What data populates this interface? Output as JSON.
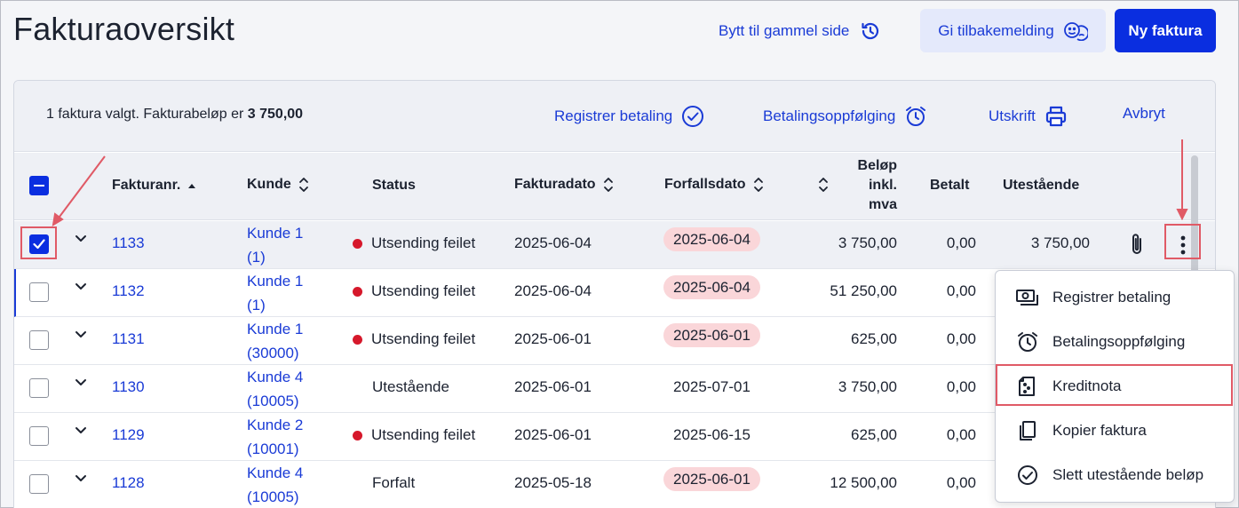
{
  "header": {
    "title": "Fakturaoversikt",
    "old_page_link": "Bytt til gammel side",
    "feedback_button": "Gi tilbakemelding",
    "new_invoice_button": "Ny faktura"
  },
  "selection_bar": {
    "text": "1 faktura valgt. Fakturabeløp er ",
    "amount": "3 750,00",
    "actions": {
      "register_payment": "Registrer betaling",
      "payment_followup": "Betalingsoppfølging",
      "print": "Utskrift",
      "cancel": "Avbryt"
    }
  },
  "columns": {
    "invoice_no": "Fakturanr.",
    "customer": "Kunde",
    "status": "Status",
    "invoice_date": "Fakturadato",
    "due_date": "Forfallsdato",
    "amount_line1": "Beløp",
    "amount_line2": "inkl.",
    "amount_line3": "mva",
    "paid": "Betalt",
    "outstanding": "Utestående"
  },
  "rows": [
    {
      "invoice_no": "1133",
      "customer_name": "Kunde 1",
      "customer_no": "(1)",
      "status": "Utsending feilet",
      "status_error": true,
      "invoice_date": "2025-06-04",
      "due_date": "2025-06-04",
      "due_overdue": true,
      "amount": "3 750,00",
      "paid": "0,00",
      "outstanding": "3 750,00",
      "selected": true
    },
    {
      "invoice_no": "1132",
      "customer_name": "Kunde 1",
      "customer_no": "(1)",
      "status": "Utsending feilet",
      "status_error": true,
      "invoice_date": "2025-06-04",
      "due_date": "2025-06-04",
      "due_overdue": true,
      "amount": "51 250,00",
      "paid": "0,00",
      "selected": false
    },
    {
      "invoice_no": "1131",
      "customer_name": "Kunde 1",
      "customer_no": "(30000)",
      "status": "Utsending feilet",
      "status_error": true,
      "invoice_date": "2025-06-01",
      "due_date": "2025-06-01",
      "due_overdue": true,
      "amount": "625,00",
      "paid": "0,00",
      "selected": false
    },
    {
      "invoice_no": "1130",
      "customer_name": "Kunde 4",
      "customer_no": "(10005)",
      "status": "Utestående",
      "status_error": false,
      "invoice_date": "2025-06-01",
      "due_date": "2025-07-01",
      "due_overdue": false,
      "amount": "3 750,00",
      "paid": "0,00",
      "selected": false
    },
    {
      "invoice_no": "1129",
      "customer_name": "Kunde 2",
      "customer_no": "(10001)",
      "status": "Utsending feilet",
      "status_error": true,
      "invoice_date": "2025-06-01",
      "due_date": "2025-06-15",
      "due_overdue": false,
      "amount": "625,00",
      "paid": "0,00",
      "selected": false
    },
    {
      "invoice_no": "1128",
      "customer_name": "Kunde 4",
      "customer_no": "(10005)",
      "status": "Forfalt",
      "status_error": false,
      "invoice_date": "2025-05-18",
      "due_date": "2025-06-01",
      "due_overdue": true,
      "amount": "12 500,00",
      "paid": "0,00",
      "selected": false
    }
  ],
  "context_menu": {
    "items": [
      {
        "label": "Registrer betaling",
        "icon": "cash-icon"
      },
      {
        "label": "Betalingsoppfølging",
        "icon": "alarm-clock-icon"
      },
      {
        "label": "Kreditnota",
        "icon": "credit-note-icon"
      },
      {
        "label": "Kopier faktura",
        "icon": "copy-icon"
      },
      {
        "label": "Slett utestående beløp",
        "icon": "check-circle-icon"
      }
    ]
  },
  "colors": {
    "accent": "#1a3bd6",
    "primary_button": "#0a2ee0",
    "error_dot": "#d6182b",
    "overdue_badge": "#fad6d9",
    "annotation": "#e05a66"
  }
}
